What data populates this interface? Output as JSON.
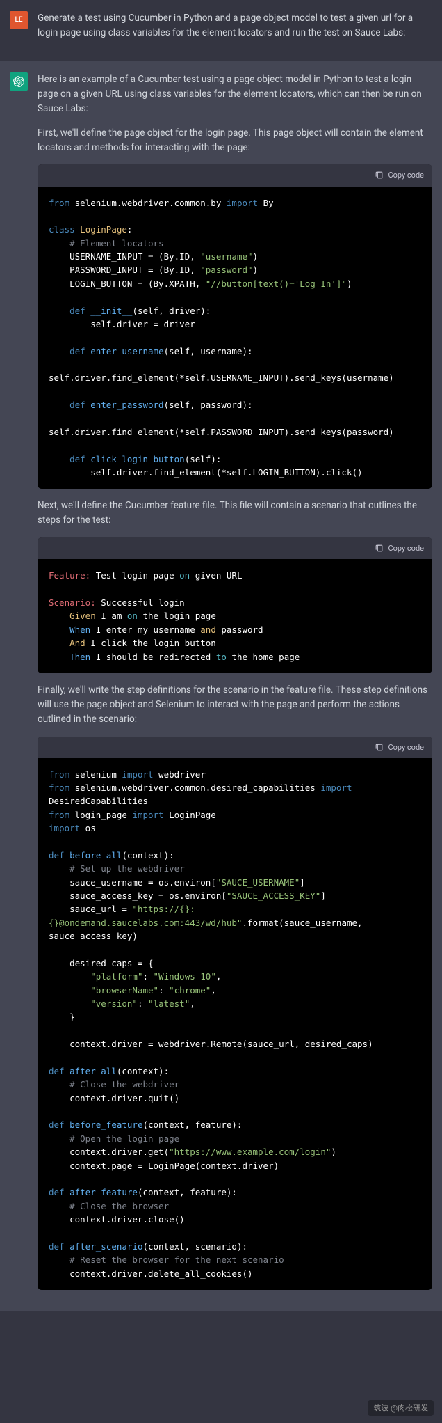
{
  "user": {
    "avatar_text": "LE",
    "prompt": "Generate a test using Cucumber in Python and a page object model to test a given url for a login page using class variables for the element locators and run the test on Sauce Labs:"
  },
  "assistant": {
    "para1": "Here is an example of a Cucumber test using a page object model in Python to test a login page on a given URL using class variables for the element locators, which can then be run on Sauce Labs:",
    "para2": "First, we'll define the page object for the login page. This page object will contain the element locators and methods for interacting with the page:",
    "para3": "Next, we'll define the Cucumber feature file. This file will contain a scenario that outlines the steps for the test:",
    "para4": "Finally, we'll write the step definitions for the scenario in the feature file. These step definitions will use the page object and Selenium to interact with the page and perform the actions outlined in the scenario:",
    "copy_label": "Copy code"
  },
  "chart_data": {
    "type": "table",
    "title": "Code snippets",
    "blocks": [
      {
        "language": "python",
        "content": "from selenium.webdriver.common.by import By\n\nclass LoginPage:\n    # Element locators\n    USERNAME_INPUT = (By.ID, \"username\")\n    PASSWORD_INPUT = (By.ID, \"password\")\n    LOGIN_BUTTON = (By.XPATH, \"//button[text()='Log In']\")\n\n    def __init__(self, driver):\n        self.driver = driver\n\n    def enter_username(self, username):\n\nself.driver.find_element(*self.USERNAME_INPUT).send_keys(username)\n\n    def enter_password(self, password):\n\nself.driver.find_element(*self.PASSWORD_INPUT).send_keys(password)\n\n    def click_login_button(self):\n        self.driver.find_element(*self.LOGIN_BUTTON).click()"
      },
      {
        "language": "gherkin",
        "content": "Feature: Test login page on given URL\n\nScenario: Successful login\n    Given I am on the login page\n    When I enter my username and password\n    And I click the login button\n    Then I should be redirected to the home page"
      },
      {
        "language": "python",
        "content": "from selenium import webdriver\nfrom selenium.webdriver.common.desired_capabilities import\nDesiredCapabilities\nfrom login_page import LoginPage\nimport os\n\ndef before_all(context):\n    # Set up the webdriver\n    sauce_username = os.environ[\"SAUCE_USERNAME\"]\n    sauce_access_key = os.environ[\"SAUCE_ACCESS_KEY\"]\n    sauce_url = \"https://{}:\n{}@ondemand.saucelabs.com:443/wd/hub\".format(sauce_username,\nsauce_access_key)\n\n    desired_caps = {\n        \"platform\": \"Windows 10\",\n        \"browserName\": \"chrome\",\n        \"version\": \"latest\",\n    }\n\n    context.driver = webdriver.Remote(sauce_url, desired_caps)\n\ndef after_all(context):\n    # Close the webdriver\n    context.driver.quit()\n\ndef before_feature(context, feature):\n    # Open the login page\n    context.driver.get(\"https://www.example.com/login\")\n    context.page = LoginPage(context.driver)\n\ndef after_feature(context, feature):\n    # Close the browser\n    context.driver.close()\n\ndef after_scenario(context, scenario):\n    # Reset the browser for the next scenario\n    context.driver.delete_all_cookies()"
      }
    ]
  },
  "watermark": "筑波 @肉松研发"
}
